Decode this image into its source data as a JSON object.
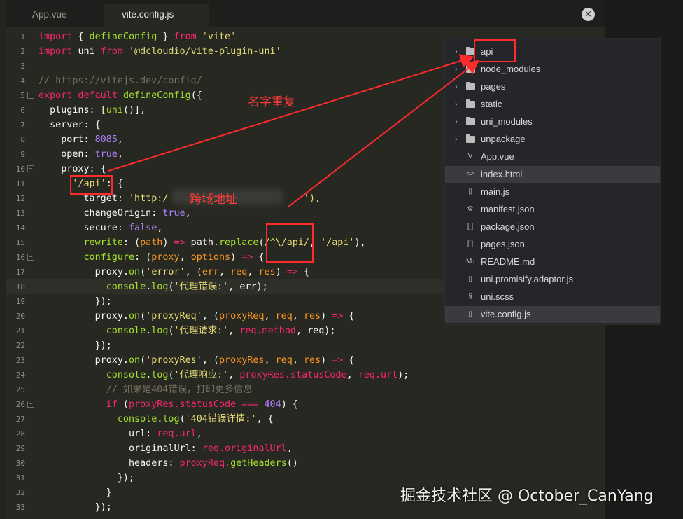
{
  "tabs": [
    {
      "label": "App.vue",
      "active": false
    },
    {
      "label": "vite.config.js",
      "active": true
    }
  ],
  "close_glyph": "×",
  "code_lines": [
    {
      "n": "1",
      "t": [
        [
          "k",
          "import "
        ],
        [
          "",
          "{ "
        ],
        [
          "f",
          "defineConfig"
        ],
        [
          "",
          " } "
        ],
        [
          "k",
          "from "
        ],
        [
          "s",
          "'vite'"
        ]
      ]
    },
    {
      "n": "2",
      "t": [
        [
          "k",
          "import "
        ],
        [
          "",
          "uni "
        ],
        [
          "k",
          "from "
        ],
        [
          "s",
          "'@dcloudio/vite-plugin-uni'"
        ]
      ]
    },
    {
      "n": "3",
      "t": []
    },
    {
      "n": "4",
      "t": [
        [
          "c",
          "// https://vitejs.dev/config/"
        ]
      ]
    },
    {
      "n": "5",
      "fold": true,
      "t": [
        [
          "k",
          "export default "
        ],
        [
          "f",
          "defineConfig"
        ],
        [
          "",
          "({"
        ]
      ]
    },
    {
      "n": "6",
      "t": [
        [
          "",
          "  plugins: ["
        ],
        [
          "f",
          "uni"
        ],
        [
          "",
          "()],"
        ]
      ]
    },
    {
      "n": "7",
      "t": [
        [
          "",
          "  server: {"
        ]
      ]
    },
    {
      "n": "8",
      "t": [
        [
          "",
          "    port: "
        ],
        [
          "n",
          "8085"
        ],
        [
          "",
          ","
        ]
      ]
    },
    {
      "n": "9",
      "t": [
        [
          "",
          "    open: "
        ],
        [
          "n",
          "true"
        ],
        [
          "",
          ","
        ]
      ]
    },
    {
      "n": "10",
      "fold": true,
      "t": [
        [
          "",
          "    proxy: {"
        ]
      ]
    },
    {
      "n": "11",
      "t": [
        [
          "",
          "      "
        ],
        [
          "s",
          "'/api'"
        ],
        [
          "",
          ": {"
        ]
      ]
    },
    {
      "n": "12",
      "t": [
        [
          "",
          "        target: "
        ],
        [
          "s",
          "'http:/"
        ],
        [
          "",
          "                        "
        ],
        [
          "s",
          "')"
        ],
        [
          "",
          ","
        ]
      ]
    },
    {
      "n": "13",
      "t": [
        [
          "",
          "        changeOrigin: "
        ],
        [
          "n",
          "true"
        ],
        [
          "",
          ","
        ]
      ]
    },
    {
      "n": "14",
      "t": [
        [
          "",
          "        secure: "
        ],
        [
          "n",
          "false"
        ],
        [
          "",
          ","
        ]
      ]
    },
    {
      "n": "15",
      "t": [
        [
          "",
          "        "
        ],
        [
          "f",
          "rewrite"
        ],
        [
          "",
          ": ("
        ],
        [
          "p",
          "path"
        ],
        [
          "",
          ") "
        ],
        [
          "k",
          "=>"
        ],
        [
          "",
          " path."
        ],
        [
          "f",
          "replace"
        ],
        [
          "",
          "("
        ],
        [
          "s",
          "/^\\/api/"
        ],
        [
          "",
          ", "
        ],
        [
          "s",
          "'/api'"
        ],
        [
          "",
          "),"
        ]
      ]
    },
    {
      "n": "16",
      "fold": true,
      "t": [
        [
          "",
          "        "
        ],
        [
          "f",
          "configure"
        ],
        [
          "",
          ": ("
        ],
        [
          "p",
          "proxy"
        ],
        [
          "",
          ", "
        ],
        [
          "p",
          "options"
        ],
        [
          "",
          ") "
        ],
        [
          "k",
          "=>"
        ],
        [
          "",
          " {"
        ]
      ]
    },
    {
      "n": "17",
      "t": [
        [
          "",
          "          proxy."
        ],
        [
          "f",
          "on"
        ],
        [
          "",
          "("
        ],
        [
          "s",
          "'error'"
        ],
        [
          "",
          ", ("
        ],
        [
          "p",
          "err"
        ],
        [
          "",
          ", "
        ],
        [
          "p",
          "req"
        ],
        [
          "",
          ", "
        ],
        [
          "p",
          "res"
        ],
        [
          "",
          ") "
        ],
        [
          "k",
          "=>"
        ],
        [
          "",
          " {"
        ]
      ]
    },
    {
      "n": "18",
      "cur": true,
      "t": [
        [
          "",
          "            "
        ],
        [
          "f",
          "console"
        ],
        [
          "",
          "."
        ],
        [
          "f",
          "log"
        ],
        [
          "",
          "("
        ],
        [
          "s",
          "'代理错误:'"
        ],
        [
          "",
          ", err);"
        ]
      ]
    },
    {
      "n": "19",
      "t": [
        [
          "",
          "          });"
        ]
      ]
    },
    {
      "n": "20",
      "t": [
        [
          "",
          "          proxy."
        ],
        [
          "f",
          "on"
        ],
        [
          "",
          "("
        ],
        [
          "s",
          "'proxyReq'"
        ],
        [
          "",
          ", ("
        ],
        [
          "p",
          "proxyReq"
        ],
        [
          "",
          ", "
        ],
        [
          "p",
          "req"
        ],
        [
          "",
          ", "
        ],
        [
          "p",
          "res"
        ],
        [
          "",
          ") "
        ],
        [
          "k",
          "=>"
        ],
        [
          "",
          " {"
        ]
      ]
    },
    {
      "n": "21",
      "t": [
        [
          "",
          "            "
        ],
        [
          "f",
          "console"
        ],
        [
          "",
          "."
        ],
        [
          "f",
          "log"
        ],
        [
          "",
          "("
        ],
        [
          "s",
          "'代理请求:'"
        ],
        [
          "",
          ", "
        ],
        [
          "k",
          "req.method"
        ],
        [
          "",
          ", req);"
        ]
      ]
    },
    {
      "n": "22",
      "t": [
        [
          "",
          "          });"
        ]
      ]
    },
    {
      "n": "23",
      "t": [
        [
          "",
          "          proxy."
        ],
        [
          "f",
          "on"
        ],
        [
          "",
          "("
        ],
        [
          "s",
          "'proxyRes'"
        ],
        [
          "",
          ", ("
        ],
        [
          "p",
          "proxyRes"
        ],
        [
          "",
          ", "
        ],
        [
          "p",
          "req"
        ],
        [
          "",
          ", "
        ],
        [
          "p",
          "res"
        ],
        [
          "",
          ") "
        ],
        [
          "k",
          "=>"
        ],
        [
          "",
          " {"
        ]
      ]
    },
    {
      "n": "24",
      "t": [
        [
          "",
          "            "
        ],
        [
          "f",
          "console"
        ],
        [
          "",
          "."
        ],
        [
          "f",
          "log"
        ],
        [
          "",
          "("
        ],
        [
          "s",
          "'代理响应:'"
        ],
        [
          "",
          ", "
        ],
        [
          "k",
          "proxyRes.statusCode"
        ],
        [
          "",
          ", "
        ],
        [
          "k",
          "req.url"
        ],
        [
          "",
          ");"
        ]
      ]
    },
    {
      "n": "25",
      "t": [
        [
          "",
          "            "
        ],
        [
          "c",
          "// 如果是404错误，打印更多信息"
        ]
      ]
    },
    {
      "n": "26",
      "fold": true,
      "t": [
        [
          "",
          "            "
        ],
        [
          "k",
          "if"
        ],
        [
          "",
          " ("
        ],
        [
          "k",
          "proxyRes.statusCode"
        ],
        [
          "k",
          " === "
        ],
        [
          "n",
          "404"
        ],
        [
          "",
          ") {"
        ]
      ]
    },
    {
      "n": "27",
      "t": [
        [
          "",
          "              "
        ],
        [
          "f",
          "console"
        ],
        [
          "",
          "."
        ],
        [
          "f",
          "log"
        ],
        [
          "",
          "("
        ],
        [
          "s",
          "'404错误详情:'"
        ],
        [
          "",
          ", {"
        ]
      ]
    },
    {
      "n": "28",
      "t": [
        [
          "",
          "                url: "
        ],
        [
          "k",
          "req.url"
        ],
        [
          "",
          ","
        ]
      ]
    },
    {
      "n": "29",
      "t": [
        [
          "",
          "                originalUrl: "
        ],
        [
          "k",
          "req.originalUrl"
        ],
        [
          "",
          ","
        ]
      ]
    },
    {
      "n": "30",
      "t": [
        [
          "",
          "                headers: "
        ],
        [
          "k",
          "proxyReq."
        ],
        [
          "f",
          "getHeaders"
        ],
        [
          "",
          "()"
        ]
      ]
    },
    {
      "n": "31",
      "t": [
        [
          "",
          "              });"
        ]
      ]
    },
    {
      "n": "32",
      "t": [
        [
          "",
          "            }"
        ]
      ]
    },
    {
      "n": "33",
      "t": [
        [
          "",
          "          });"
        ]
      ]
    }
  ],
  "file_tree": [
    {
      "label": "api",
      "type": "folder",
      "selected": false
    },
    {
      "label": "node_modules",
      "type": "folder",
      "selected": false
    },
    {
      "label": "pages",
      "type": "folder",
      "selected": false
    },
    {
      "label": "static",
      "type": "folder",
      "selected": false
    },
    {
      "label": "uni_modules",
      "type": "folder",
      "selected": false
    },
    {
      "label": "unpackage",
      "type": "folder",
      "selected": false
    },
    {
      "label": "App.vue",
      "type": "vue",
      "icon": "V",
      "selected": false
    },
    {
      "label": "index.html",
      "type": "html",
      "icon": "<>",
      "selected": true
    },
    {
      "label": "main.js",
      "type": "file",
      "icon": "▯",
      "selected": false
    },
    {
      "label": "manifest.json",
      "type": "json",
      "icon": "⚙",
      "selected": false
    },
    {
      "label": "package.json",
      "type": "json",
      "icon": "[ ]",
      "selected": false
    },
    {
      "label": "pages.json",
      "type": "json",
      "icon": "[ ]",
      "selected": false
    },
    {
      "label": "README.md",
      "type": "md",
      "icon": "M↓",
      "selected": false
    },
    {
      "label": "uni.promisify.adaptor.js",
      "type": "file",
      "icon": "▯",
      "selected": false
    },
    {
      "label": "uni.scss",
      "type": "scss",
      "icon": "§",
      "selected": false
    },
    {
      "label": "vite.config.js",
      "type": "file",
      "icon": "▯",
      "selected": true
    }
  ],
  "annotations": {
    "duplicate_name": "名字重复",
    "cross_domain": "跨域地址"
  },
  "watermark": "掘金技术社区 @ October_CanYang",
  "colors": {
    "annotation": "#ff2a2a",
    "editor_bg": "#272822",
    "panel_bg": "#25262a"
  }
}
